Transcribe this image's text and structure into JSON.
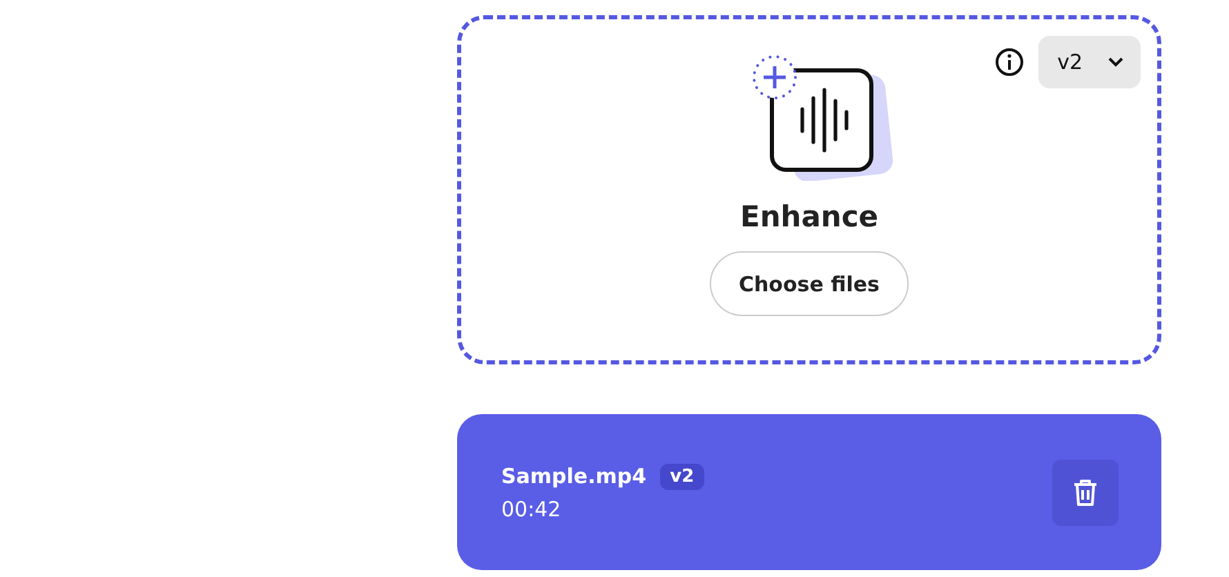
{
  "dropzone": {
    "title": "Enhance",
    "button": "Choose files",
    "version": "v2"
  },
  "files": [
    {
      "name": "Sample.mp4",
      "version": "v2",
      "duration": "00:42"
    }
  ]
}
